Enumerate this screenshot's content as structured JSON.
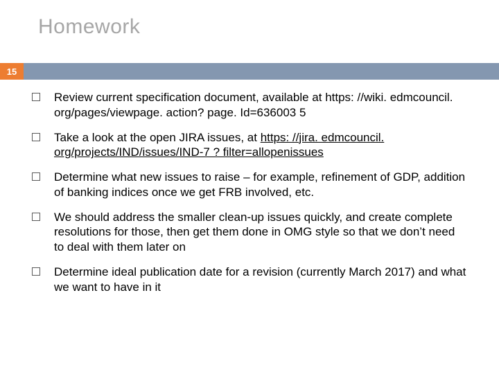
{
  "title": "Homework",
  "page_number": "15",
  "bullets": [
    {
      "pre": "Review current specification document, available at https: //wiki. edmcouncil. org/pages/viewpage. action? page. Id=636003 5",
      "link": "",
      "post": ""
    },
    {
      "pre": "Take a look at the open JIRA issues, at ",
      "link": "https: //jira. edmcouncil. org/projects/IND/issues/IND-7 ? filter=allopenissues",
      "post": ""
    },
    {
      "pre": "Determine what new issues to raise – for example, refinement of GDP, addition of banking indices once we get FRB involved, etc.",
      "link": "",
      "post": ""
    },
    {
      "pre": "We should address the smaller clean-up issues quickly, and create complete resolutions for those, then get them done in OMG style so that we don’t need to deal with them later on",
      "link": "",
      "post": ""
    },
    {
      "pre": "Determine ideal publication date for a revision (currently March 2017) and what we want to have in it",
      "link": "",
      "post": ""
    }
  ]
}
